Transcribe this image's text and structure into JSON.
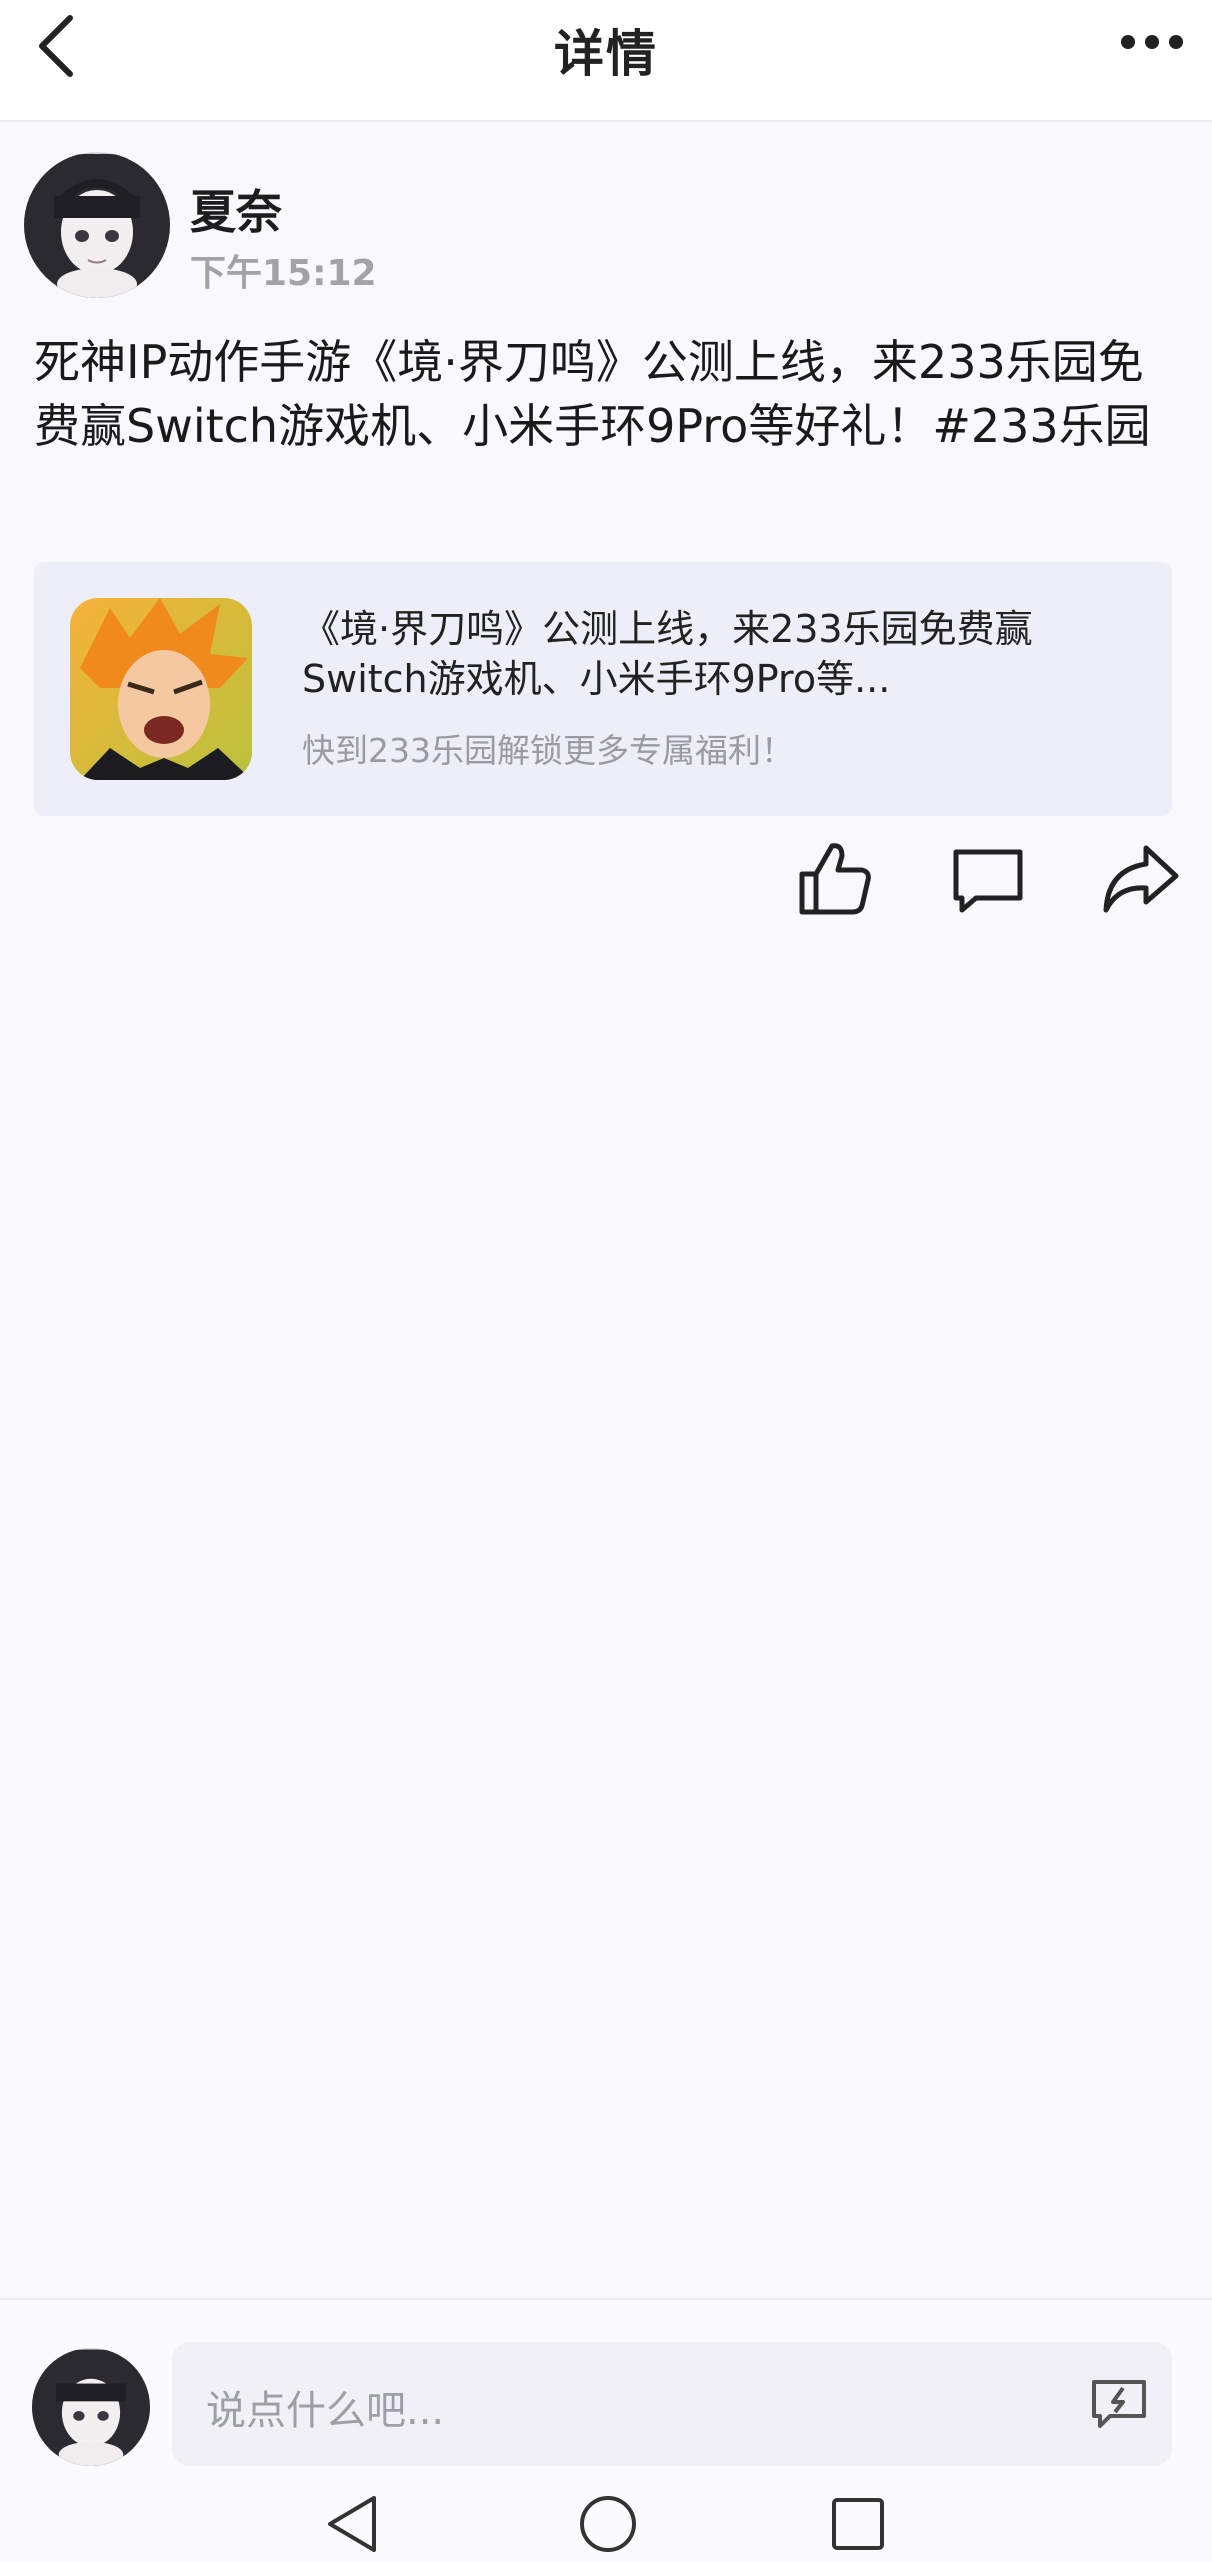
{
  "header": {
    "title": "详情",
    "back_icon": "chevron-left-icon",
    "more_icon": "more-dots-icon"
  },
  "post": {
    "author_name": "夏奈",
    "time": "下午15:12",
    "text": "死神IP动作手游《境·界刀鸣》公测上线，来233乐园免费赢Switch游戏机、小米手环9Pro等好礼！#233乐园",
    "link_card": {
      "title": "《境·界刀鸣》公测上线，来233乐园免费赢Switch游戏机、小米手环9Pro等...",
      "subtitle": "快到233乐园解锁更多专属福利！",
      "icon": "game-app-icon"
    },
    "actions": {
      "like_icon": "thumbs-up-icon",
      "comment_icon": "comment-bubble-icon",
      "share_icon": "share-arrow-icon"
    }
  },
  "comment_bar": {
    "placeholder": "说点什么吧...",
    "quick_reply_icon": "quick-reply-icon"
  },
  "system_nav": {
    "back_icon": "triangle-back-icon",
    "home_icon": "circle-home-icon",
    "recent_icon": "square-recent-icon"
  },
  "colors": {
    "background": "#f9f8fc",
    "card_background": "#edeef7",
    "muted_text": "#a2a2a8"
  }
}
